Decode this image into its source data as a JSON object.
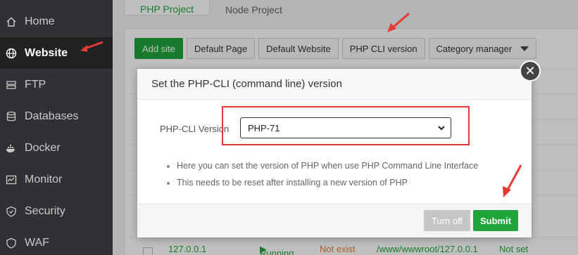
{
  "sidebar": {
    "items": [
      {
        "label": "Home",
        "icon": "home-icon"
      },
      {
        "label": "Website",
        "icon": "globe-icon",
        "active": true
      },
      {
        "label": "FTP",
        "icon": "ftp-icon"
      },
      {
        "label": "Databases",
        "icon": "database-icon"
      },
      {
        "label": "Docker",
        "icon": "docker-icon"
      },
      {
        "label": "Monitor",
        "icon": "monitor-icon"
      },
      {
        "label": "Security",
        "icon": "shield-icon"
      },
      {
        "label": "WAF",
        "icon": "waf-icon"
      }
    ]
  },
  "tabs": [
    {
      "label": "PHP Project",
      "active": true
    },
    {
      "label": "Node Project",
      "active": false
    }
  ],
  "toolbar": {
    "add_site": "Add site",
    "default_page": "Default Page",
    "default_website": "Default Website",
    "php_cli_version": "PHP CLI version",
    "category_manager": "Category manager"
  },
  "table_row": {
    "ip": "127.0.0.1",
    "status": "Running",
    "backup": "Not exist",
    "path": "/www/wwwroot/127.0.0.1",
    "expire": "Not set"
  },
  "modal": {
    "title": "Set the PHP-CLI (command line) version",
    "field_label": "PHP-CLI Version",
    "selected_value": "PHP-71",
    "help": [
      "Here you can set the version of PHP when use PHP Command Line Interface",
      "This needs to be reset after installing a new version of PHP"
    ],
    "turn_off": "Turn off",
    "submit": "Submit",
    "close_glyph": "✕"
  },
  "colors": {
    "accent": "#20a53a",
    "highlight": "#e53935",
    "sidebar_bg": "#2f3134"
  }
}
